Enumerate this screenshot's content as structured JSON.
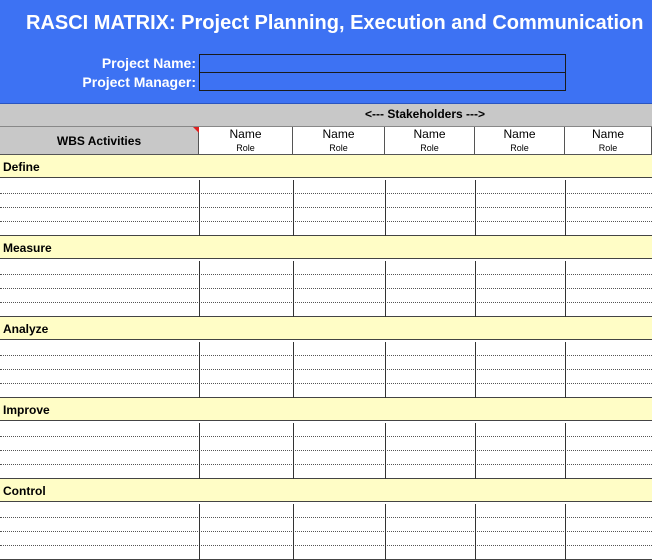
{
  "title": "RASCI MATRIX:  Project Planning, Execution and Communication",
  "project": {
    "name_label": "Project Name:",
    "manager_label": "Project Manager:"
  },
  "stakeholders_label": "<--- Stakeholders --->",
  "wbs_label": "WBS Activities",
  "stakeholders": [
    {
      "name": "Name",
      "role": "Role"
    },
    {
      "name": "Name",
      "role": "Role"
    },
    {
      "name": "Name",
      "role": "Role"
    },
    {
      "name": "Name",
      "role": "Role"
    },
    {
      "name": "Name",
      "role": "Role"
    }
  ],
  "sections": [
    {
      "title": "Define"
    },
    {
      "title": "Measure"
    },
    {
      "title": "Analyze"
    },
    {
      "title": "Improve"
    },
    {
      "title": "Control"
    }
  ],
  "colors": {
    "header": "#3d72f3",
    "section": "#fffdc6",
    "band": "#c8c8c8",
    "marker": "#e02020"
  }
}
